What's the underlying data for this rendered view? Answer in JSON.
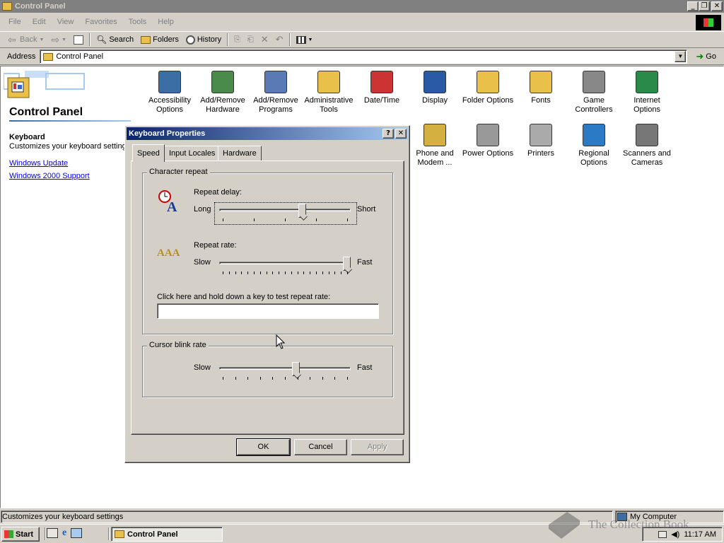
{
  "window": {
    "title": "Control Panel"
  },
  "menu": [
    "File",
    "Edit",
    "View",
    "Favorites",
    "Tools",
    "Help"
  ],
  "toolbar": {
    "back": "Back",
    "search": "Search",
    "folders": "Folders",
    "history": "History"
  },
  "address": {
    "label": "Address",
    "value": "Control Panel",
    "go": "Go"
  },
  "left": {
    "title": "Control Panel",
    "selected_name": "Keyboard",
    "selected_desc": "Customizes your keyboard setting",
    "links": [
      "Windows Update",
      "Windows 2000 Support"
    ]
  },
  "icons": [
    {
      "line1": "Accessibility",
      "line2": "Options",
      "icon": "accessibility-icon"
    },
    {
      "line1": "Add/Remove",
      "line2": "Hardware",
      "icon": "add-remove-hardware-icon"
    },
    {
      "line1": "Add/Remove",
      "line2": "Programs",
      "icon": "add-remove-programs-icon"
    },
    {
      "line1": "Administrative",
      "line2": "Tools",
      "icon": "administrative-tools-icon"
    },
    {
      "line1": "Date/Time",
      "line2": "",
      "icon": "date-time-icon"
    },
    {
      "line1": "Display",
      "line2": "",
      "icon": "display-icon"
    },
    {
      "line1": "Folder Options",
      "line2": "",
      "icon": "folder-options-icon"
    },
    {
      "line1": "Fonts",
      "line2": "",
      "icon": "fonts-icon"
    },
    {
      "line1": "Game",
      "line2": "Controllers",
      "icon": "game-controllers-icon"
    },
    {
      "line1": "Internet",
      "line2": "Options",
      "icon": "internet-options-icon"
    },
    {
      "line1": "Phone and",
      "line2": "Modem ...",
      "icon": "phone-modem-icon"
    },
    {
      "line1": "Power Options",
      "line2": "",
      "icon": "power-options-icon"
    },
    {
      "line1": "Printers",
      "line2": "",
      "icon": "printers-icon"
    },
    {
      "line1": "Regional",
      "line2": "Options",
      "icon": "regional-options-icon"
    },
    {
      "line1": "Scanners and",
      "line2": "Cameras",
      "icon": "scanners-cameras-icon"
    }
  ],
  "dialog": {
    "title": "Keyboard Properties",
    "tabs": [
      "Speed",
      "Input Locales",
      "Hardware"
    ],
    "active_tab": "Speed",
    "char_repeat": {
      "group": "Character repeat",
      "delay_label": "Repeat delay:",
      "delay_min": "Long",
      "delay_max": "Short",
      "delay_value": 0.64,
      "rate_label": "Repeat rate:",
      "rate_min": "Slow",
      "rate_max": "Fast",
      "rate_value": 1.0,
      "test_label": "Click here and hold down a key to test repeat rate:",
      "test_value": ""
    },
    "cursor_blink": {
      "group": "Cursor blink rate",
      "min": "Slow",
      "max": "Fast",
      "value": 0.59
    },
    "buttons": {
      "ok": "OK",
      "cancel": "Cancel",
      "apply": "Apply"
    }
  },
  "statusbar": {
    "text": "Customizes your keyboard settings",
    "zone": "My Computer"
  },
  "taskbar": {
    "start": "Start",
    "task": "Control Panel",
    "clock": "11:17 AM"
  },
  "watermark": "The Collection Book"
}
